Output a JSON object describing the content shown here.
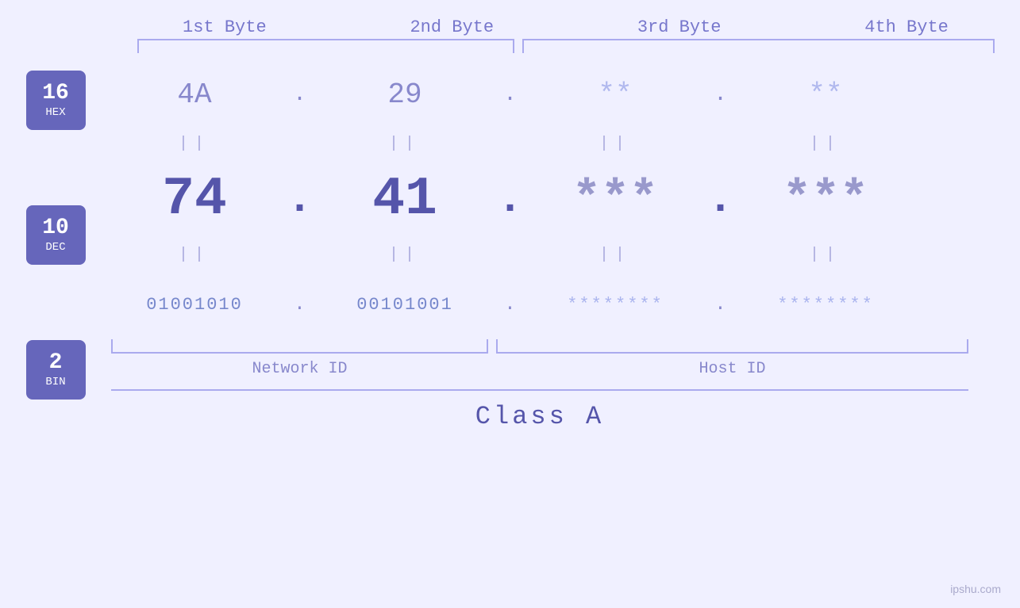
{
  "page": {
    "background": "#f0f0ff",
    "watermark": "ipshu.com"
  },
  "headers": {
    "byte1": "1st Byte",
    "byte2": "2nd Byte",
    "byte3": "3rd Byte",
    "byte4": "4th Byte"
  },
  "badges": [
    {
      "id": "hex-badge",
      "number": "16",
      "label": "HEX"
    },
    {
      "id": "dec-badge",
      "number": "10",
      "label": "DEC"
    },
    {
      "id": "bin-badge",
      "number": "2",
      "label": "BIN"
    }
  ],
  "rows": {
    "hex": {
      "byte1": "4A",
      "byte2": "29",
      "byte3": "**",
      "byte4": "**",
      "dot": "."
    },
    "dec": {
      "byte1": "74",
      "byte2": "41",
      "byte3": "***",
      "byte4": "***",
      "dot": "."
    },
    "bin": {
      "byte1": "01001010",
      "byte2": "00101001",
      "byte3": "********",
      "byte4": "********",
      "dot": "."
    }
  },
  "equals": "||",
  "labels": {
    "network_id": "Network ID",
    "host_id": "Host ID",
    "class": "Class A"
  }
}
